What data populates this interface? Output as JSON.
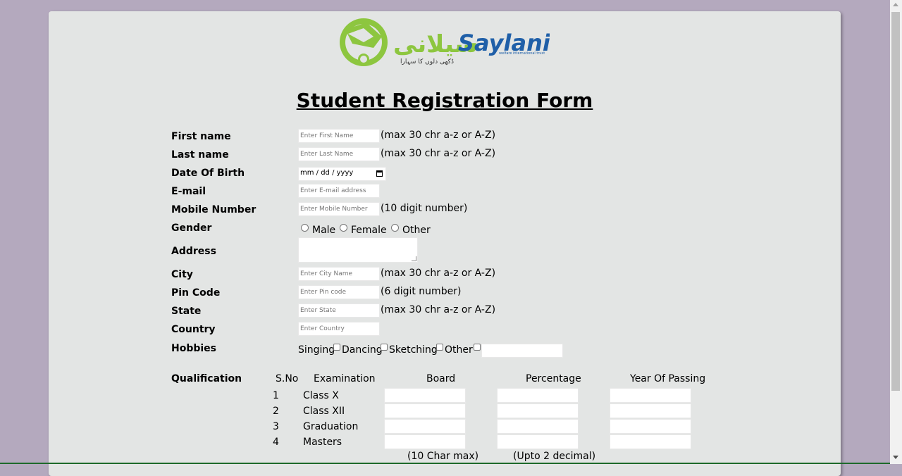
{
  "logo": {
    "text": "Saylani",
    "tagline": "welfare international trust",
    "urdu": "سیلانی"
  },
  "form_title": "Student Registration Form",
  "fields": {
    "first_name": {
      "label": "First name",
      "placeholder": "Enter First Name",
      "hint": "(max 30 chr a-z or A-Z)"
    },
    "last_name": {
      "label": "Last name",
      "placeholder": "Enter Last Name",
      "hint": "(max 30 chr a-z or A-Z)"
    },
    "dob": {
      "label": "Date Of Birth",
      "value": "mm / dd / yyyy"
    },
    "email": {
      "label": "E-mail",
      "placeholder": "Enter E-mail address"
    },
    "mobile": {
      "label": "Mobile Number",
      "placeholder": "Enter Mobile Number",
      "hint": "(10 digit number)"
    },
    "gender": {
      "label": "Gender",
      "options": [
        "Male",
        "Female",
        "Other"
      ]
    },
    "address": {
      "label": "Address"
    },
    "city": {
      "label": "City",
      "placeholder": "Enter City Name",
      "hint": "(max 30 chr a-z or A-Z)"
    },
    "pin": {
      "label": "Pin Code",
      "placeholder": "Enter Pin code",
      "hint": "(6 digit number)"
    },
    "state": {
      "label": "State",
      "placeholder": "Enter State",
      "hint": "(max 30 chr a-z or A-Z)"
    },
    "country": {
      "label": "Country",
      "placeholder": "Enter Country"
    },
    "hobbies": {
      "label": "Hobbies",
      "options": [
        "Singing",
        "Dancing",
        "Sketching",
        "Other"
      ]
    }
  },
  "qualification": {
    "label": "Qualification",
    "headers": [
      "S.No",
      "Examination",
      "Board",
      "Percentage",
      "Year Of Passing"
    ],
    "rows": [
      {
        "sno": "1",
        "exam": "Class X"
      },
      {
        "sno": "2",
        "exam": "Class XII"
      },
      {
        "sno": "3",
        "exam": "Graduation"
      },
      {
        "sno": "4",
        "exam": "Masters"
      }
    ],
    "board_note": "(10 Char max)",
    "percentage_note": "(Upto 2 decimal)"
  },
  "colors": {
    "background": "#b4a9be",
    "card": "#e3e5e4",
    "logo_green": "#8dc63f",
    "logo_blue": "#1f5fa8"
  }
}
